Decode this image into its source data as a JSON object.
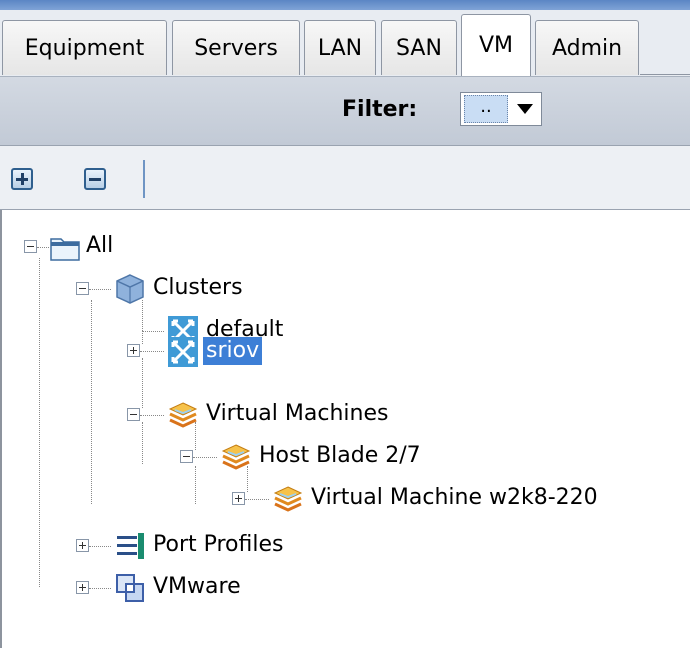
{
  "tabs": [
    {
      "label": "Equipment",
      "active": false
    },
    {
      "label": "Servers",
      "active": false
    },
    {
      "label": "LAN",
      "active": false
    },
    {
      "label": "SAN",
      "active": false
    },
    {
      "label": "VM",
      "active": true
    },
    {
      "label": "Admin",
      "active": false
    }
  ],
  "filter": {
    "label": "Filter:",
    "value": ".."
  },
  "toolbar": {
    "expand_icon": "plus-box-icon",
    "collapse_icon": "minus-box-icon"
  },
  "tree": {
    "all": "All",
    "clusters": "Clusters",
    "default": "default",
    "sriov": "sriov",
    "virtual_machines": "Virtual Machines",
    "host_blade": "Host Blade 2/7",
    "vm_w2k8": "Virtual Machine w2k8-220",
    "port_profiles": "Port Profiles",
    "vmware": "VMware",
    "selected": "sriov"
  },
  "colors": {
    "selection": "#3d7fd6",
    "filterbar": "#c8cfda",
    "accent_blue": "#2f5f8e"
  }
}
